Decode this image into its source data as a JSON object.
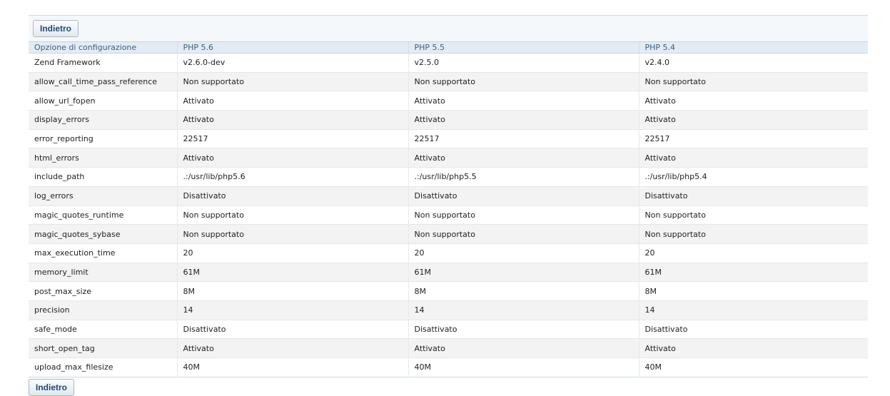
{
  "buttons": {
    "back_top": "Indietro",
    "back_bottom": "Indietro"
  },
  "table": {
    "headers": [
      "Opzione di configurazione",
      "PHP 5.6",
      "PHP 5.5",
      "PHP 5.4"
    ],
    "rows": [
      [
        "Zend Framework",
        "v2.6.0-dev",
        "v2.5.0",
        "v2.4.0"
      ],
      [
        "allow_call_time_pass_reference",
        "Non supportato",
        "Non supportato",
        "Non supportato"
      ],
      [
        "allow_url_fopen",
        "Attivato",
        "Attivato",
        "Attivato"
      ],
      [
        "display_errors",
        "Attivato",
        "Attivato",
        "Attivato"
      ],
      [
        "error_reporting",
        "22517",
        "22517",
        "22517"
      ],
      [
        "html_errors",
        "Attivato",
        "Attivato",
        "Attivato"
      ],
      [
        "include_path",
        ".:/usr/lib/php5.6",
        ".:/usr/lib/php5.5",
        ".:/usr/lib/php5.4"
      ],
      [
        "log_errors",
        "Disattivato",
        "Disattivato",
        "Disattivato"
      ],
      [
        "magic_quotes_runtime",
        "Non supportato",
        "Non supportato",
        "Non supportato"
      ],
      [
        "magic_quotes_sybase",
        "Non supportato",
        "Non supportato",
        "Non supportato"
      ],
      [
        "max_execution_time",
        "20",
        "20",
        "20"
      ],
      [
        "memory_limit",
        "61M",
        "61M",
        "61M"
      ],
      [
        "post_max_size",
        "8M",
        "8M",
        "8M"
      ],
      [
        "precision",
        "14",
        "14",
        "14"
      ],
      [
        "safe_mode",
        "Disattivato",
        "Disattivato",
        "Disattivato"
      ],
      [
        "short_open_tag",
        "Attivato",
        "Attivato",
        "Attivato"
      ],
      [
        "upload_max_filesize",
        "40M",
        "40M",
        "40M"
      ]
    ]
  }
}
